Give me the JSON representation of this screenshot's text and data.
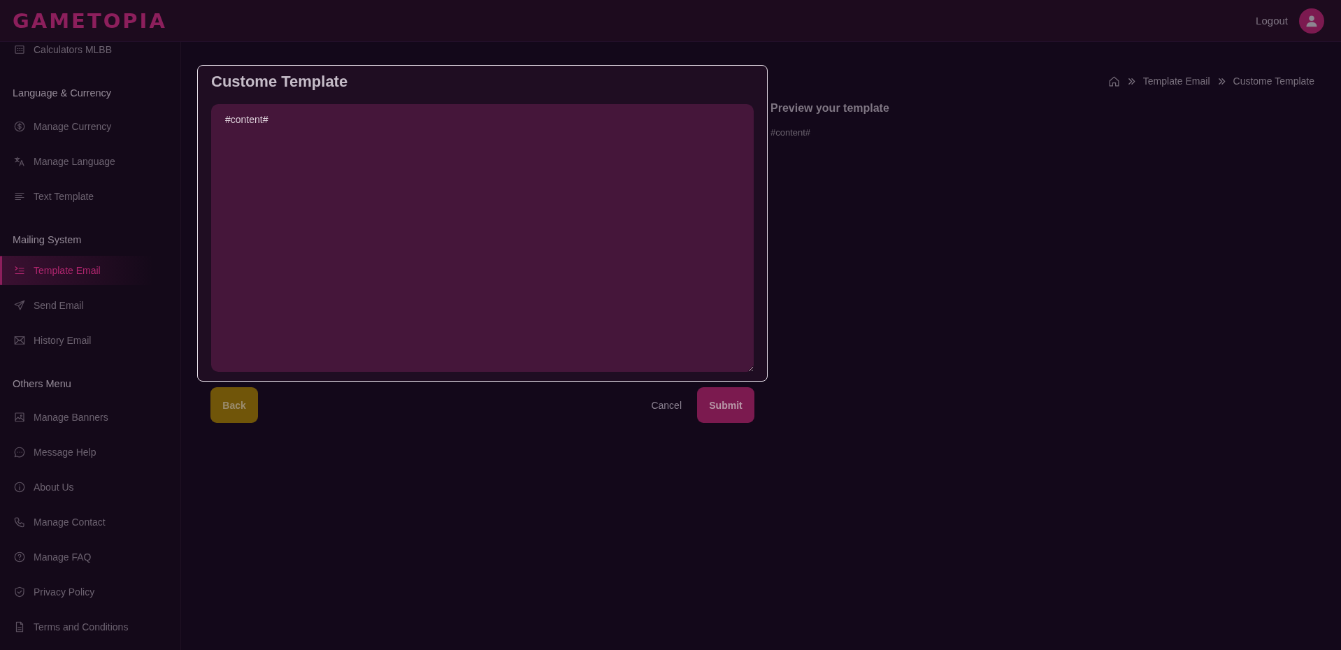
{
  "header": {
    "logo": "GAMETOPIA",
    "logout": "Logout"
  },
  "sidebar": {
    "items": [
      {
        "kind": "link",
        "label": "Calculators MLBB",
        "selected": false
      },
      {
        "kind": "heading",
        "label": "Language & Currency"
      },
      {
        "kind": "link",
        "label": "Manage Currency",
        "selected": false
      },
      {
        "kind": "link",
        "label": "Manage Language",
        "selected": false
      },
      {
        "kind": "link",
        "label": "Text Template",
        "selected": false
      },
      {
        "kind": "heading",
        "label": "Mailing System"
      },
      {
        "kind": "link",
        "label": "Template Email",
        "selected": true
      },
      {
        "kind": "link",
        "label": "Send Email",
        "selected": false
      },
      {
        "kind": "link",
        "label": "History Email",
        "selected": false
      },
      {
        "kind": "heading",
        "label": "Others Menu"
      },
      {
        "kind": "link",
        "label": "Manage Banners",
        "selected": false
      },
      {
        "kind": "link",
        "label": "Message Help",
        "selected": false
      },
      {
        "kind": "link",
        "label": "About Us",
        "selected": false
      },
      {
        "kind": "link",
        "label": "Manage Contact",
        "selected": false
      },
      {
        "kind": "link",
        "label": "Manage FAQ",
        "selected": false
      },
      {
        "kind": "link",
        "label": "Privacy Policy",
        "selected": false
      },
      {
        "kind": "link",
        "label": "Terms and Conditions",
        "selected": false
      }
    ]
  },
  "breadcrumb": [
    "Template Email",
    "Custome Template"
  ],
  "editor": {
    "title": "Custome Template",
    "value": "#content#"
  },
  "buttons": {
    "back": "Back",
    "cancel": "Cancel",
    "submit": "Submit"
  },
  "preview": {
    "title": "Preview your template",
    "content": "#content#"
  }
}
